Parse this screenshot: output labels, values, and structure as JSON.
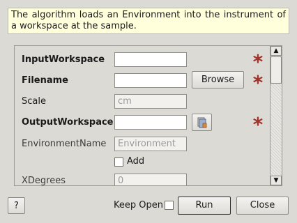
{
  "description": "The algorithm loads an Environment into the instrument of a workspace at the sample.",
  "properties": {
    "input_workspace": {
      "label": "InputWorkspace",
      "value": ""
    },
    "filename": {
      "label": "Filename",
      "value": "",
      "browse_label": "Browse"
    },
    "scale": {
      "label": "Scale",
      "placeholder": "cm"
    },
    "output_workspace": {
      "label": "OutputWorkspace",
      "value": ""
    },
    "environment_name": {
      "label": "EnvironmentName",
      "placeholder": "Environment"
    },
    "add": {
      "label": "Add",
      "checked": false
    },
    "x_degrees": {
      "label": "XDegrees",
      "placeholder": "0"
    }
  },
  "footer": {
    "help_label": "?",
    "keep_open_label": "Keep Open",
    "run_label": "Run",
    "close_label": "Close"
  },
  "colors": {
    "required_star": "#a3322b",
    "description_bg": "#ffffdc",
    "dialog_bg": "#dcdad5"
  },
  "icons": {
    "required": "asterisk-icon",
    "workspace_picker": "workspace-picker-icon"
  }
}
